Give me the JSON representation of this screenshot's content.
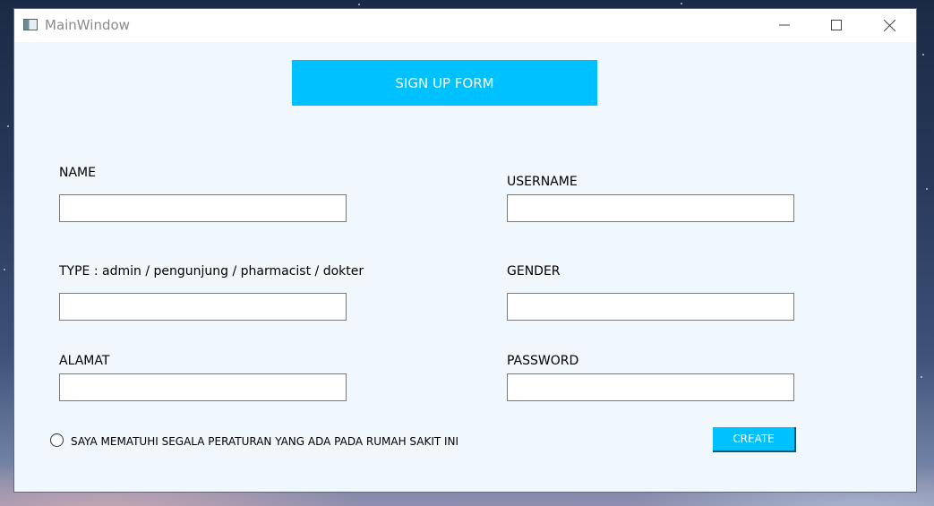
{
  "window": {
    "title": "MainWindow"
  },
  "form": {
    "header": "SIGN UP FORM",
    "fields": {
      "name": {
        "label": "NAME",
        "value": ""
      },
      "username": {
        "label": "USERNAME",
        "value": ""
      },
      "type": {
        "label": "TYPE : admin / pengunjung / pharmacist / dokter",
        "value": ""
      },
      "gender": {
        "label": "GENDER",
        "value": ""
      },
      "alamat": {
        "label": "ALAMAT",
        "value": ""
      },
      "password": {
        "label": "PASSWORD",
        "value": ""
      }
    },
    "agreement": {
      "label": "SAYA MEMATUHI SEGALA PERATURAN YANG ADA PADA RUMAH SAKIT INI",
      "checked": false
    },
    "submit_label": "CREATE"
  },
  "colors": {
    "accent": "#00c1ff",
    "window_bg": "#f0f7fd",
    "titlebar_bg": "#ffffff"
  },
  "icons": {
    "app": "app-window-icon",
    "minimize": "minimize-icon",
    "maximize": "maximize-icon",
    "close": "close-icon",
    "radio": "radio-icon"
  }
}
